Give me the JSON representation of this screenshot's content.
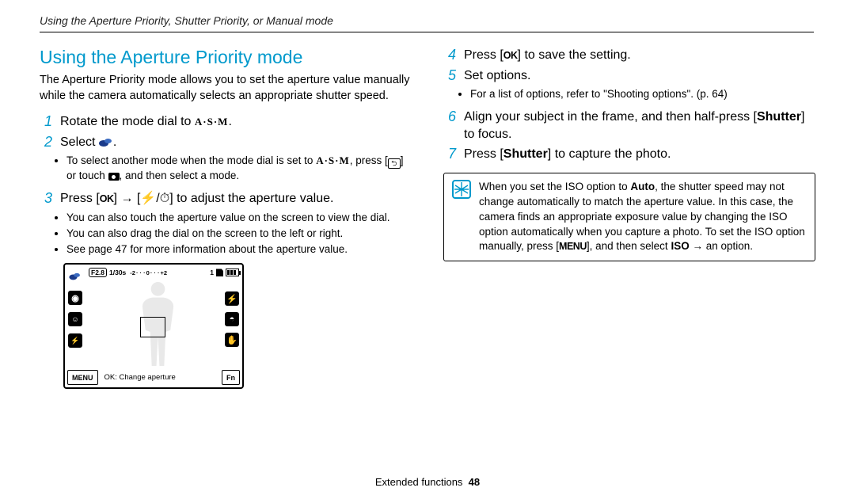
{
  "breadcrumb": "Using the Aperture Priority, Shutter Priority, or Manual mode",
  "section_title": "Using the Aperture Priority mode",
  "intro": "The Aperture Priority mode allows you to set the aperture value manually while the camera automatically selects an appropriate shutter speed.",
  "left_steps": {
    "s1": {
      "num": "1",
      "pre": "Rotate the mode dial to ",
      "asm": "A·S·M",
      "post": "."
    },
    "s2": {
      "num": "2",
      "pre": "Select ",
      "post": "."
    },
    "s2_sub_pre": "To select another mode when the mode dial is set to ",
    "s2_sub_asm": "A·S·M",
    "s2_sub_mid": ", press [",
    "s2_sub_or": "] or touch ",
    "s2_sub_end": ", and then select a mode.",
    "s3": {
      "num": "3",
      "pre": "Press [",
      "ok": "OK",
      "arrow": "] → [",
      "glyph1": "⚡",
      "slash": "/",
      "glyph2": "⏱",
      "post": "] to adjust the aperture value."
    },
    "s3_sub": [
      "You can also touch the aperture value on the screen to view the dial.",
      "You can also drag the dial on the screen to the left or right.",
      "See page 47 for more information about the aperture value."
    ]
  },
  "right_steps": {
    "s4": {
      "num": "4",
      "pre": "Press [",
      "ok": "OK",
      "post": "] to save the setting."
    },
    "s5": {
      "num": "5",
      "text": "Set options."
    },
    "s5_sub": "For a list of options, refer to \"Shooting options\". (p. 64)",
    "s6": {
      "num": "6",
      "pre": "Align your subject in the frame, and then half-press [",
      "bold": "Shutter",
      "post": "] to focus."
    },
    "s7": {
      "num": "7",
      "pre": "Press [",
      "bold": "Shutter",
      "post": "] to capture the photo."
    }
  },
  "note": {
    "pre": "When you set the ISO option to ",
    "auto": "Auto",
    "mid": ", the shutter speed may not change automatically to match the aperture value. In this case, the camera finds an appropriate exposure value by changing the ISO option automatically when you capture a photo. To set the ISO option manually, press [",
    "menu": "MENU",
    "end1": "], and then select ",
    "iso": "ISO",
    "arrow": " → an option."
  },
  "screenshot": {
    "f_value": "F2.8",
    "shutter": "1/30s",
    "ev_minus": "-2",
    "ev_zero": "0",
    "ev_plus": "+2",
    "count": "1",
    "menu_btn": "MENU",
    "hint": "OK: Change aperture",
    "fn_btn": "Fn"
  },
  "footer": {
    "label": "Extended functions",
    "page": "48"
  }
}
